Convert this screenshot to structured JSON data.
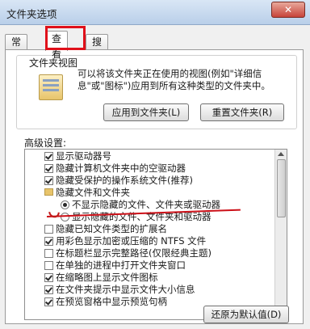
{
  "window": {
    "title": "文件夹选项",
    "close_glyph": "✕"
  },
  "tabs": [
    {
      "label": "常规",
      "active": false
    },
    {
      "label": "查看",
      "active": true
    },
    {
      "label": "搜索",
      "active": false
    }
  ],
  "folder_views": {
    "title": "文件夹视图",
    "description": "可以将该文件夹正在使用的视图(例如\"详细信息\"或\"图标\")应用到所有这种类型的文件夹中。",
    "apply_button": "应用到文件夹(L)",
    "reset_button": "重置文件夹(R)"
  },
  "advanced": {
    "label": "高级设置:",
    "items": [
      {
        "type": "checkbox",
        "checked": true,
        "label": "显示驱动器号"
      },
      {
        "type": "checkbox",
        "checked": true,
        "label": "隐藏计算机文件夹中的空驱动器"
      },
      {
        "type": "checkbox",
        "checked": true,
        "label": "隐藏受保护的操作系统文件(推荐)"
      },
      {
        "type": "folder",
        "label": "隐藏文件和文件夹"
      },
      {
        "type": "radio",
        "checked": true,
        "label": "不显示隐藏的文件、文件夹或驱动器"
      },
      {
        "type": "radio",
        "checked": false,
        "label": "显示隐藏的文件、文件夹和驱动器"
      },
      {
        "type": "checkbox",
        "checked": false,
        "label": "隐藏已知文件类型的扩展名"
      },
      {
        "type": "checkbox",
        "checked": true,
        "label": "用彩色显示加密或压缩的 NTFS 文件"
      },
      {
        "type": "checkbox",
        "checked": false,
        "label": "在标题栏显示完整路径(仅限经典主题)"
      },
      {
        "type": "checkbox",
        "checked": false,
        "label": "在单独的进程中打开文件夹窗口"
      },
      {
        "type": "checkbox",
        "checked": true,
        "label": "在缩略图上显示文件图标"
      },
      {
        "type": "checkbox",
        "checked": true,
        "label": "在文件夹提示中显示文件大小信息"
      },
      {
        "type": "checkbox",
        "checked": true,
        "label": "在预览窗格中显示预览句柄"
      }
    ],
    "restore_button": "还原为默认值(D)"
  },
  "colors": {
    "highlight": "#e0101a",
    "annotation": "#cc1018"
  }
}
